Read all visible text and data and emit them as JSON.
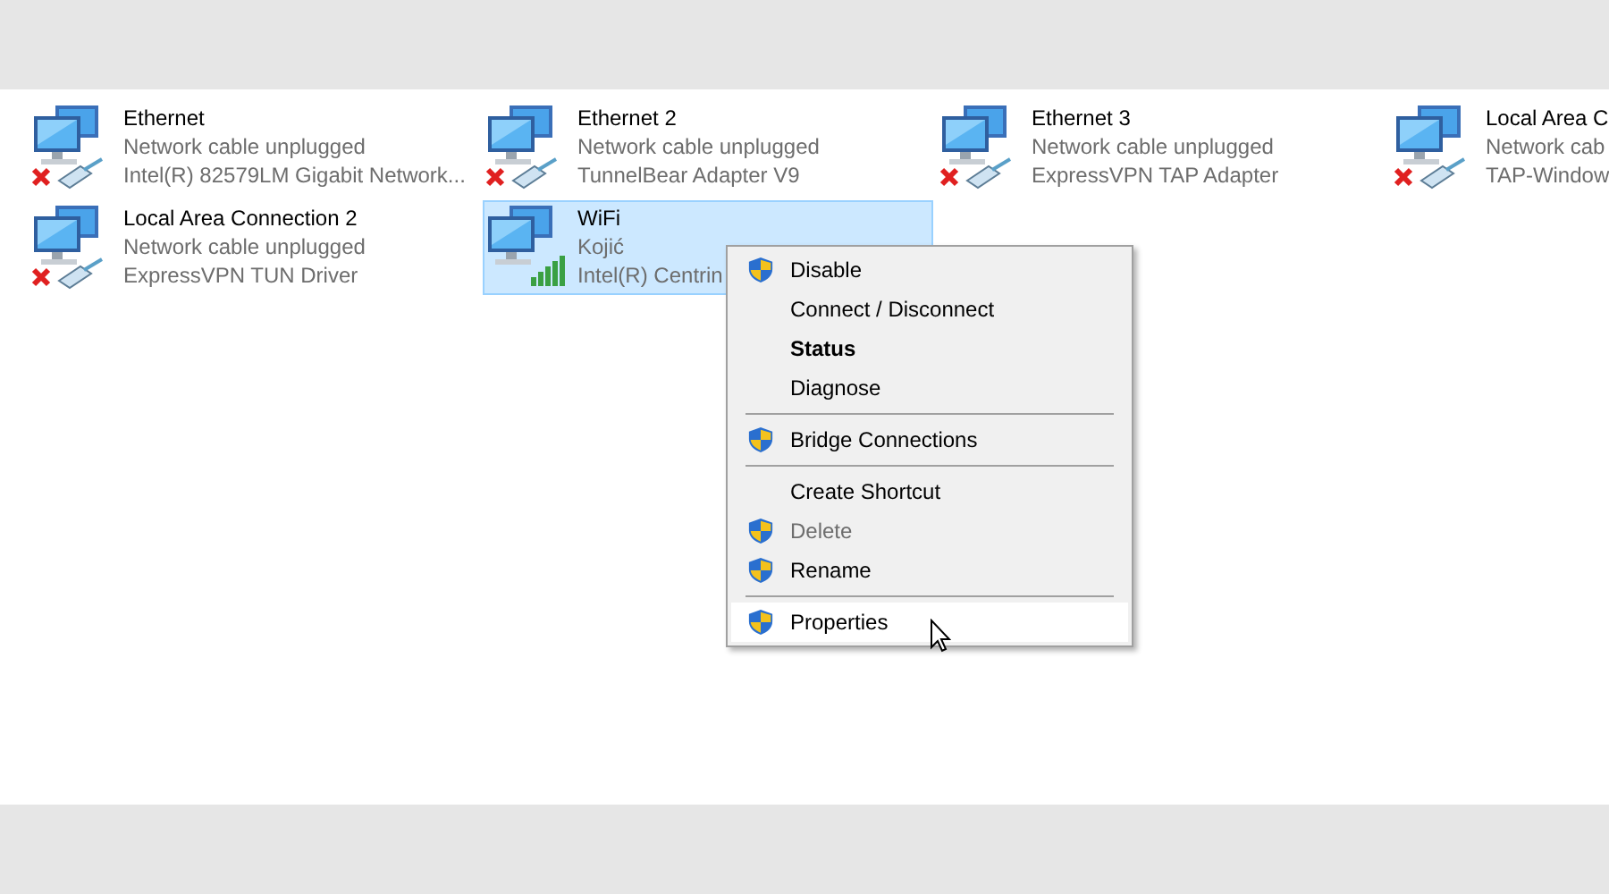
{
  "connections": [
    {
      "name": "Ethernet",
      "status": "Network cable unplugged",
      "device": "Intel(R) 82579LM Gigabit Network...",
      "kind": "unplugged",
      "selected": false
    },
    {
      "name": "Ethernet 2",
      "status": "Network cable unplugged",
      "device": "TunnelBear Adapter V9",
      "kind": "unplugged",
      "selected": false
    },
    {
      "name": "Ethernet 3",
      "status": "Network cable unplugged",
      "device": "ExpressVPN TAP Adapter",
      "kind": "unplugged",
      "selected": false
    },
    {
      "name": "Local Area C",
      "status": "Network cab",
      "device": "TAP-Window",
      "kind": "unplugged",
      "selected": false
    },
    {
      "name": "Local Area Connection 2",
      "status": "Network cable unplugged",
      "device": "ExpressVPN TUN Driver",
      "kind": "unplugged",
      "selected": false
    },
    {
      "name": "WiFi",
      "status": "Kojić",
      "device": "Intel(R) Centrin",
      "kind": "wifi",
      "selected": true
    }
  ],
  "context_menu": {
    "items": [
      {
        "kind": "item",
        "label": "Disable",
        "shield": true,
        "disabled": false,
        "default": false,
        "selected": false
      },
      {
        "kind": "item",
        "label": "Connect / Disconnect",
        "shield": false,
        "disabled": false,
        "default": false,
        "selected": false
      },
      {
        "kind": "item",
        "label": "Status",
        "shield": false,
        "disabled": false,
        "default": true,
        "selected": false
      },
      {
        "kind": "item",
        "label": "Diagnose",
        "shield": false,
        "disabled": false,
        "default": false,
        "selected": false
      },
      {
        "kind": "separator"
      },
      {
        "kind": "item",
        "label": "Bridge Connections",
        "shield": true,
        "disabled": false,
        "default": false,
        "selected": false
      },
      {
        "kind": "separator"
      },
      {
        "kind": "item",
        "label": "Create Shortcut",
        "shield": false,
        "disabled": false,
        "default": false,
        "selected": false
      },
      {
        "kind": "item",
        "label": "Delete",
        "shield": true,
        "disabled": true,
        "default": false,
        "selected": false
      },
      {
        "kind": "item",
        "label": "Rename",
        "shield": true,
        "disabled": false,
        "default": false,
        "selected": false
      },
      {
        "kind": "separator"
      },
      {
        "kind": "item",
        "label": "Properties",
        "shield": true,
        "disabled": false,
        "default": false,
        "selected": true
      }
    ]
  }
}
